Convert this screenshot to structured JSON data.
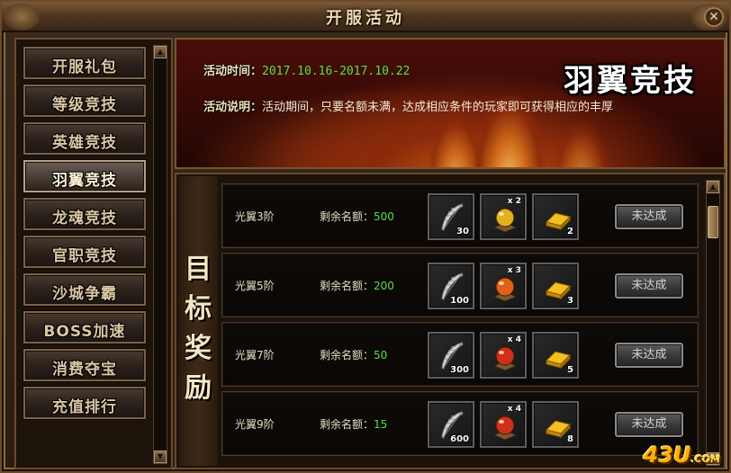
{
  "window": {
    "title": "开服活动",
    "close_label": "✕"
  },
  "menu": {
    "items": [
      {
        "label": "开服礼包",
        "active": false
      },
      {
        "label": "等级竞技",
        "active": false
      },
      {
        "label": "英雄竞技",
        "active": false
      },
      {
        "label": "羽翼竞技",
        "active": true
      },
      {
        "label": "龙魂竞技",
        "active": false
      },
      {
        "label": "官职竞技",
        "active": false
      },
      {
        "label": "沙城争霸",
        "active": false
      },
      {
        "label": "BOSS加速",
        "active": false
      },
      {
        "label": "消费夺宝",
        "active": false
      },
      {
        "label": "充值排行",
        "active": false
      }
    ]
  },
  "banner": {
    "title": "羽翼竞技",
    "time_label": "活动时间：",
    "time_value": "2017.10.16-2017.10.22",
    "desc_label": "活动说明：",
    "desc_value": "活动期间，只要名额未满，达成相应条件的玩家即可获得相应的丰厚"
  },
  "rewards": {
    "side_label": [
      "目",
      "标",
      "奖",
      "励"
    ],
    "quota_label": "剩余名额：",
    "rows": [
      {
        "name": "光翼3阶",
        "quota": "500",
        "feather_count": "30",
        "orb_mult": "x 2",
        "orb_color": "#e0b020",
        "gold_count": "2",
        "status": "未达成"
      },
      {
        "name": "光翼5阶",
        "quota": "200",
        "feather_count": "100",
        "orb_mult": "x 3",
        "orb_color": "#e0601a",
        "gold_count": "3",
        "status": "未达成"
      },
      {
        "name": "光翼7阶",
        "quota": "50",
        "feather_count": "300",
        "orb_mult": "x 4",
        "orb_color": "#d0301a",
        "gold_count": "5",
        "status": "未达成"
      },
      {
        "name": "光翼9阶",
        "quota": "15",
        "feather_count": "600",
        "orb_mult": "x 4",
        "orb_color": "#d0301a",
        "gold_count": "8",
        "status": "未达成"
      }
    ]
  },
  "watermark": {
    "text": "43U",
    "suffix": ".COM"
  }
}
